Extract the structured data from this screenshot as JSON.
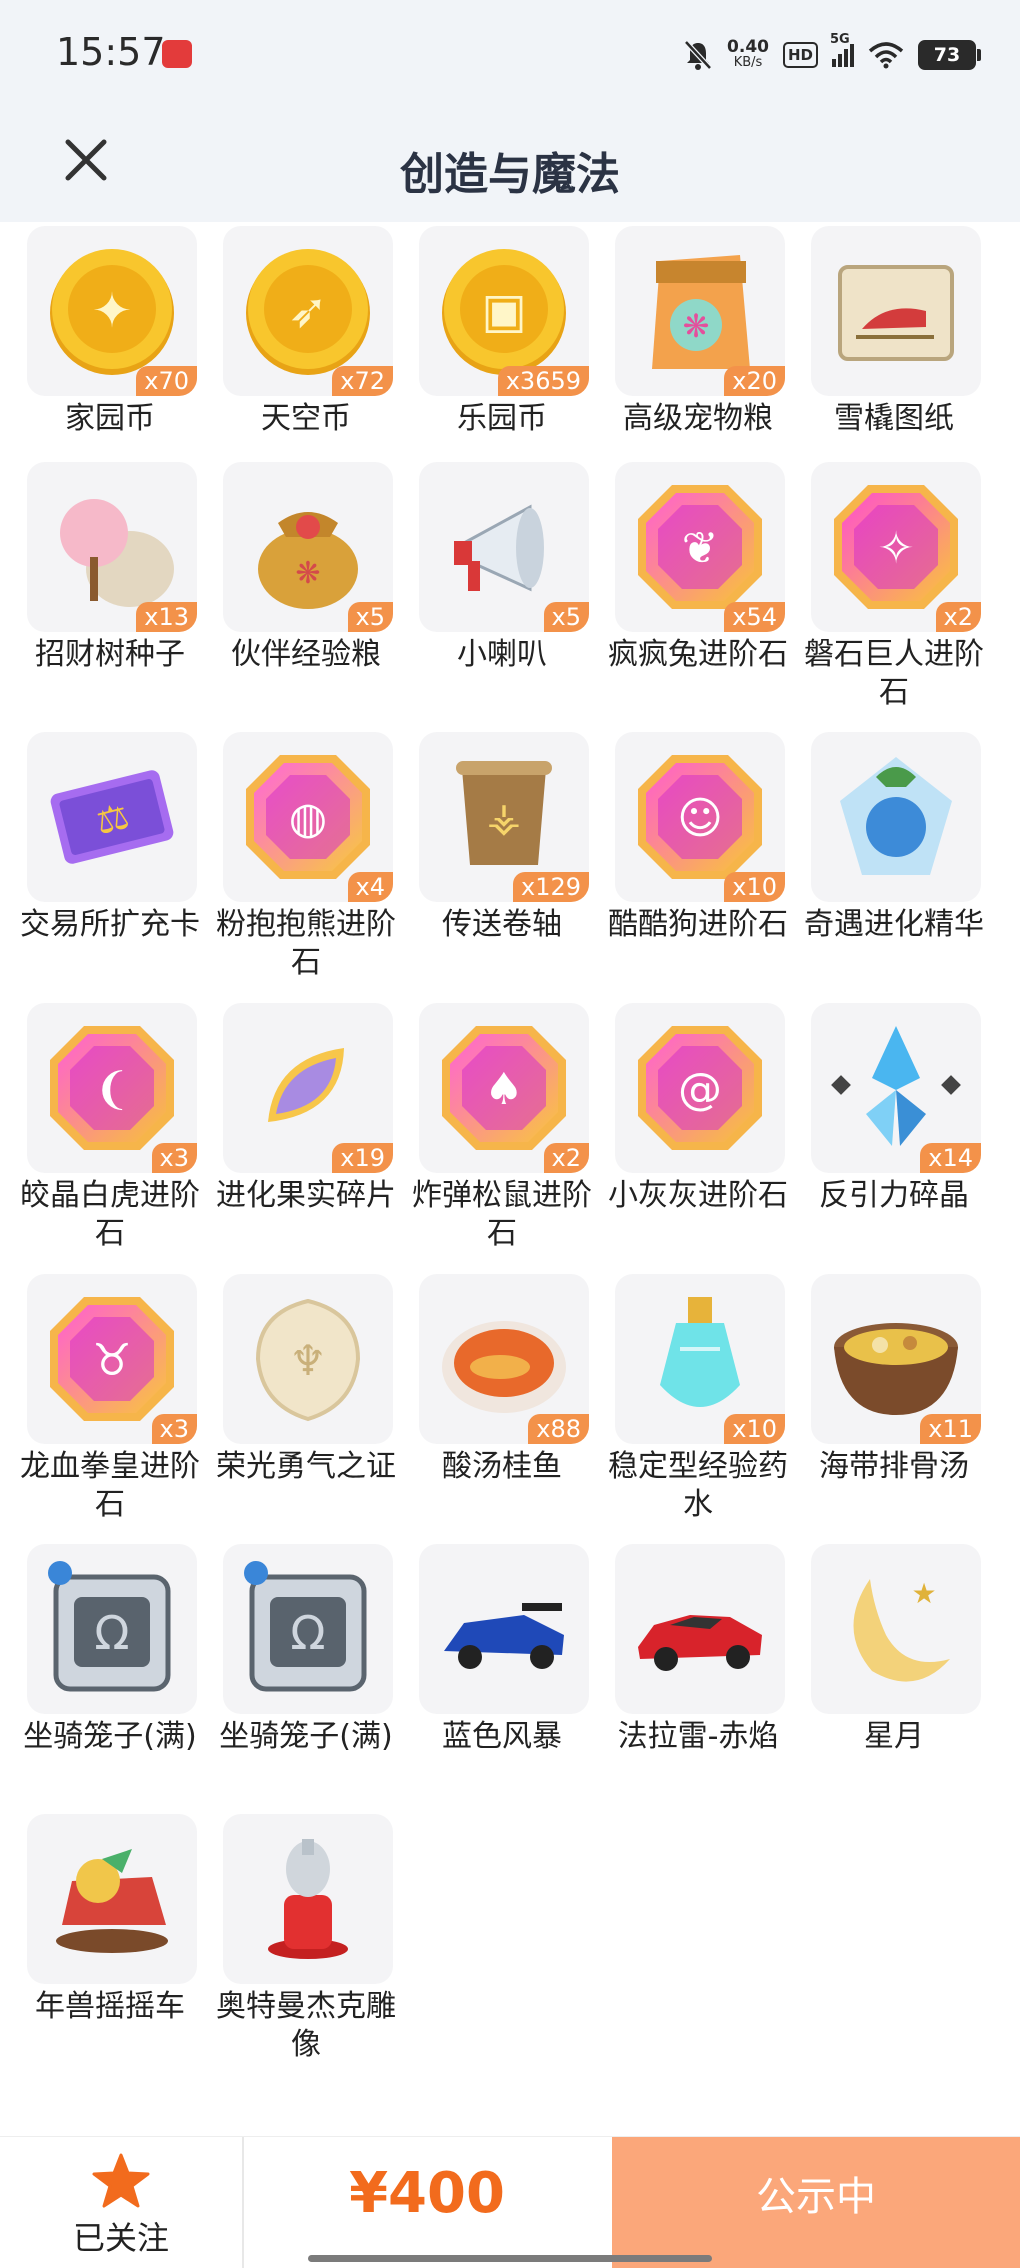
{
  "status": {
    "time": "15:57",
    "speed_value": "0.40",
    "speed_unit": "KB/s",
    "hd": "HD",
    "network": "5G",
    "battery": "73"
  },
  "header": {
    "title": "创造与魔法"
  },
  "items": [
    {
      "name": "家园币",
      "count": "x70",
      "icon": "gold-coin-home-icon"
    },
    {
      "name": "天空币",
      "count": "x72",
      "icon": "gold-coin-sky-icon"
    },
    {
      "name": "乐园币",
      "count": "x3659",
      "icon": "gold-coin-park-icon"
    },
    {
      "name": "高级宠物粮",
      "count": "x20",
      "icon": "pet-food-bag-icon"
    },
    {
      "name": "雪橇图纸",
      "count": "",
      "icon": "sled-blueprint-icon"
    },
    {
      "name": "招财树种子",
      "count": "x13",
      "icon": "tree-seed-bag-icon"
    },
    {
      "name": "伙伴经验粮",
      "count": "x5",
      "icon": "partner-exp-bag-icon"
    },
    {
      "name": "小喇叭",
      "count": "x5",
      "icon": "megaphone-icon"
    },
    {
      "name": "疯疯兔进阶石",
      "count": "x54",
      "icon": "rabbit-gem-icon"
    },
    {
      "name": "磐石巨人进阶石",
      "count": "x2",
      "icon": "giant-gem-icon"
    },
    {
      "name": "交易所扩充卡",
      "count": "",
      "icon": "exchange-card-icon"
    },
    {
      "name": "粉抱抱熊进阶石",
      "count": "x4",
      "icon": "bear-gem-icon"
    },
    {
      "name": "传送卷轴",
      "count": "x129",
      "icon": "teleport-scroll-icon"
    },
    {
      "name": "酷酷狗进阶石",
      "count": "x10",
      "icon": "dog-gem-icon"
    },
    {
      "name": "奇遇进化精华",
      "count": "",
      "icon": "evolution-essence-icon"
    },
    {
      "name": "皎晶白虎进阶石",
      "count": "x3",
      "icon": "tiger-gem-icon"
    },
    {
      "name": "进化果实碎片",
      "count": "x19",
      "icon": "fruit-fragment-icon"
    },
    {
      "name": "炸弹松鼠进阶石",
      "count": "x2",
      "icon": "squirrel-gem-icon"
    },
    {
      "name": "小灰灰进阶石",
      "count": "",
      "icon": "lollipop-gem-icon"
    },
    {
      "name": "反引力碎晶",
      "count": "x14",
      "icon": "antigravity-crystal-icon"
    },
    {
      "name": "龙血拳皇进阶石",
      "count": "x3",
      "icon": "bull-gem-icon"
    },
    {
      "name": "荣光勇气之证",
      "count": "",
      "icon": "honor-emblem-icon"
    },
    {
      "name": "酸汤桂鱼",
      "count": "x88",
      "icon": "fish-soup-icon"
    },
    {
      "name": "稳定型经验药水",
      "count": "x10",
      "icon": "exp-potion-icon"
    },
    {
      "name": "海带排骨汤",
      "count": "x11",
      "icon": "rib-soup-icon"
    },
    {
      "name": "坐骑笼子(满)",
      "count": "",
      "icon": "mount-cage-icon"
    },
    {
      "name": "坐骑笼子(满)",
      "count": "",
      "icon": "mount-cage-icon"
    },
    {
      "name": "蓝色风暴",
      "count": "",
      "icon": "blue-race-car-icon"
    },
    {
      "name": "法拉雷-赤焰",
      "count": "",
      "icon": "red-sports-car-icon"
    },
    {
      "name": "星月",
      "count": "",
      "icon": "star-moon-icon"
    },
    {
      "name": "年兽摇摇车",
      "count": "",
      "icon": "nian-rocking-car-icon"
    },
    {
      "name": "奥特曼杰克雕像",
      "count": "",
      "icon": "ultraman-statue-icon"
    }
  ],
  "footer": {
    "follow_label": "已关注",
    "price": "¥400",
    "button_label": "公示中"
  },
  "colors": {
    "accent_orange": "#f26b1d",
    "button_bg": "#fba77a",
    "count_badge": "#f3924a"
  }
}
